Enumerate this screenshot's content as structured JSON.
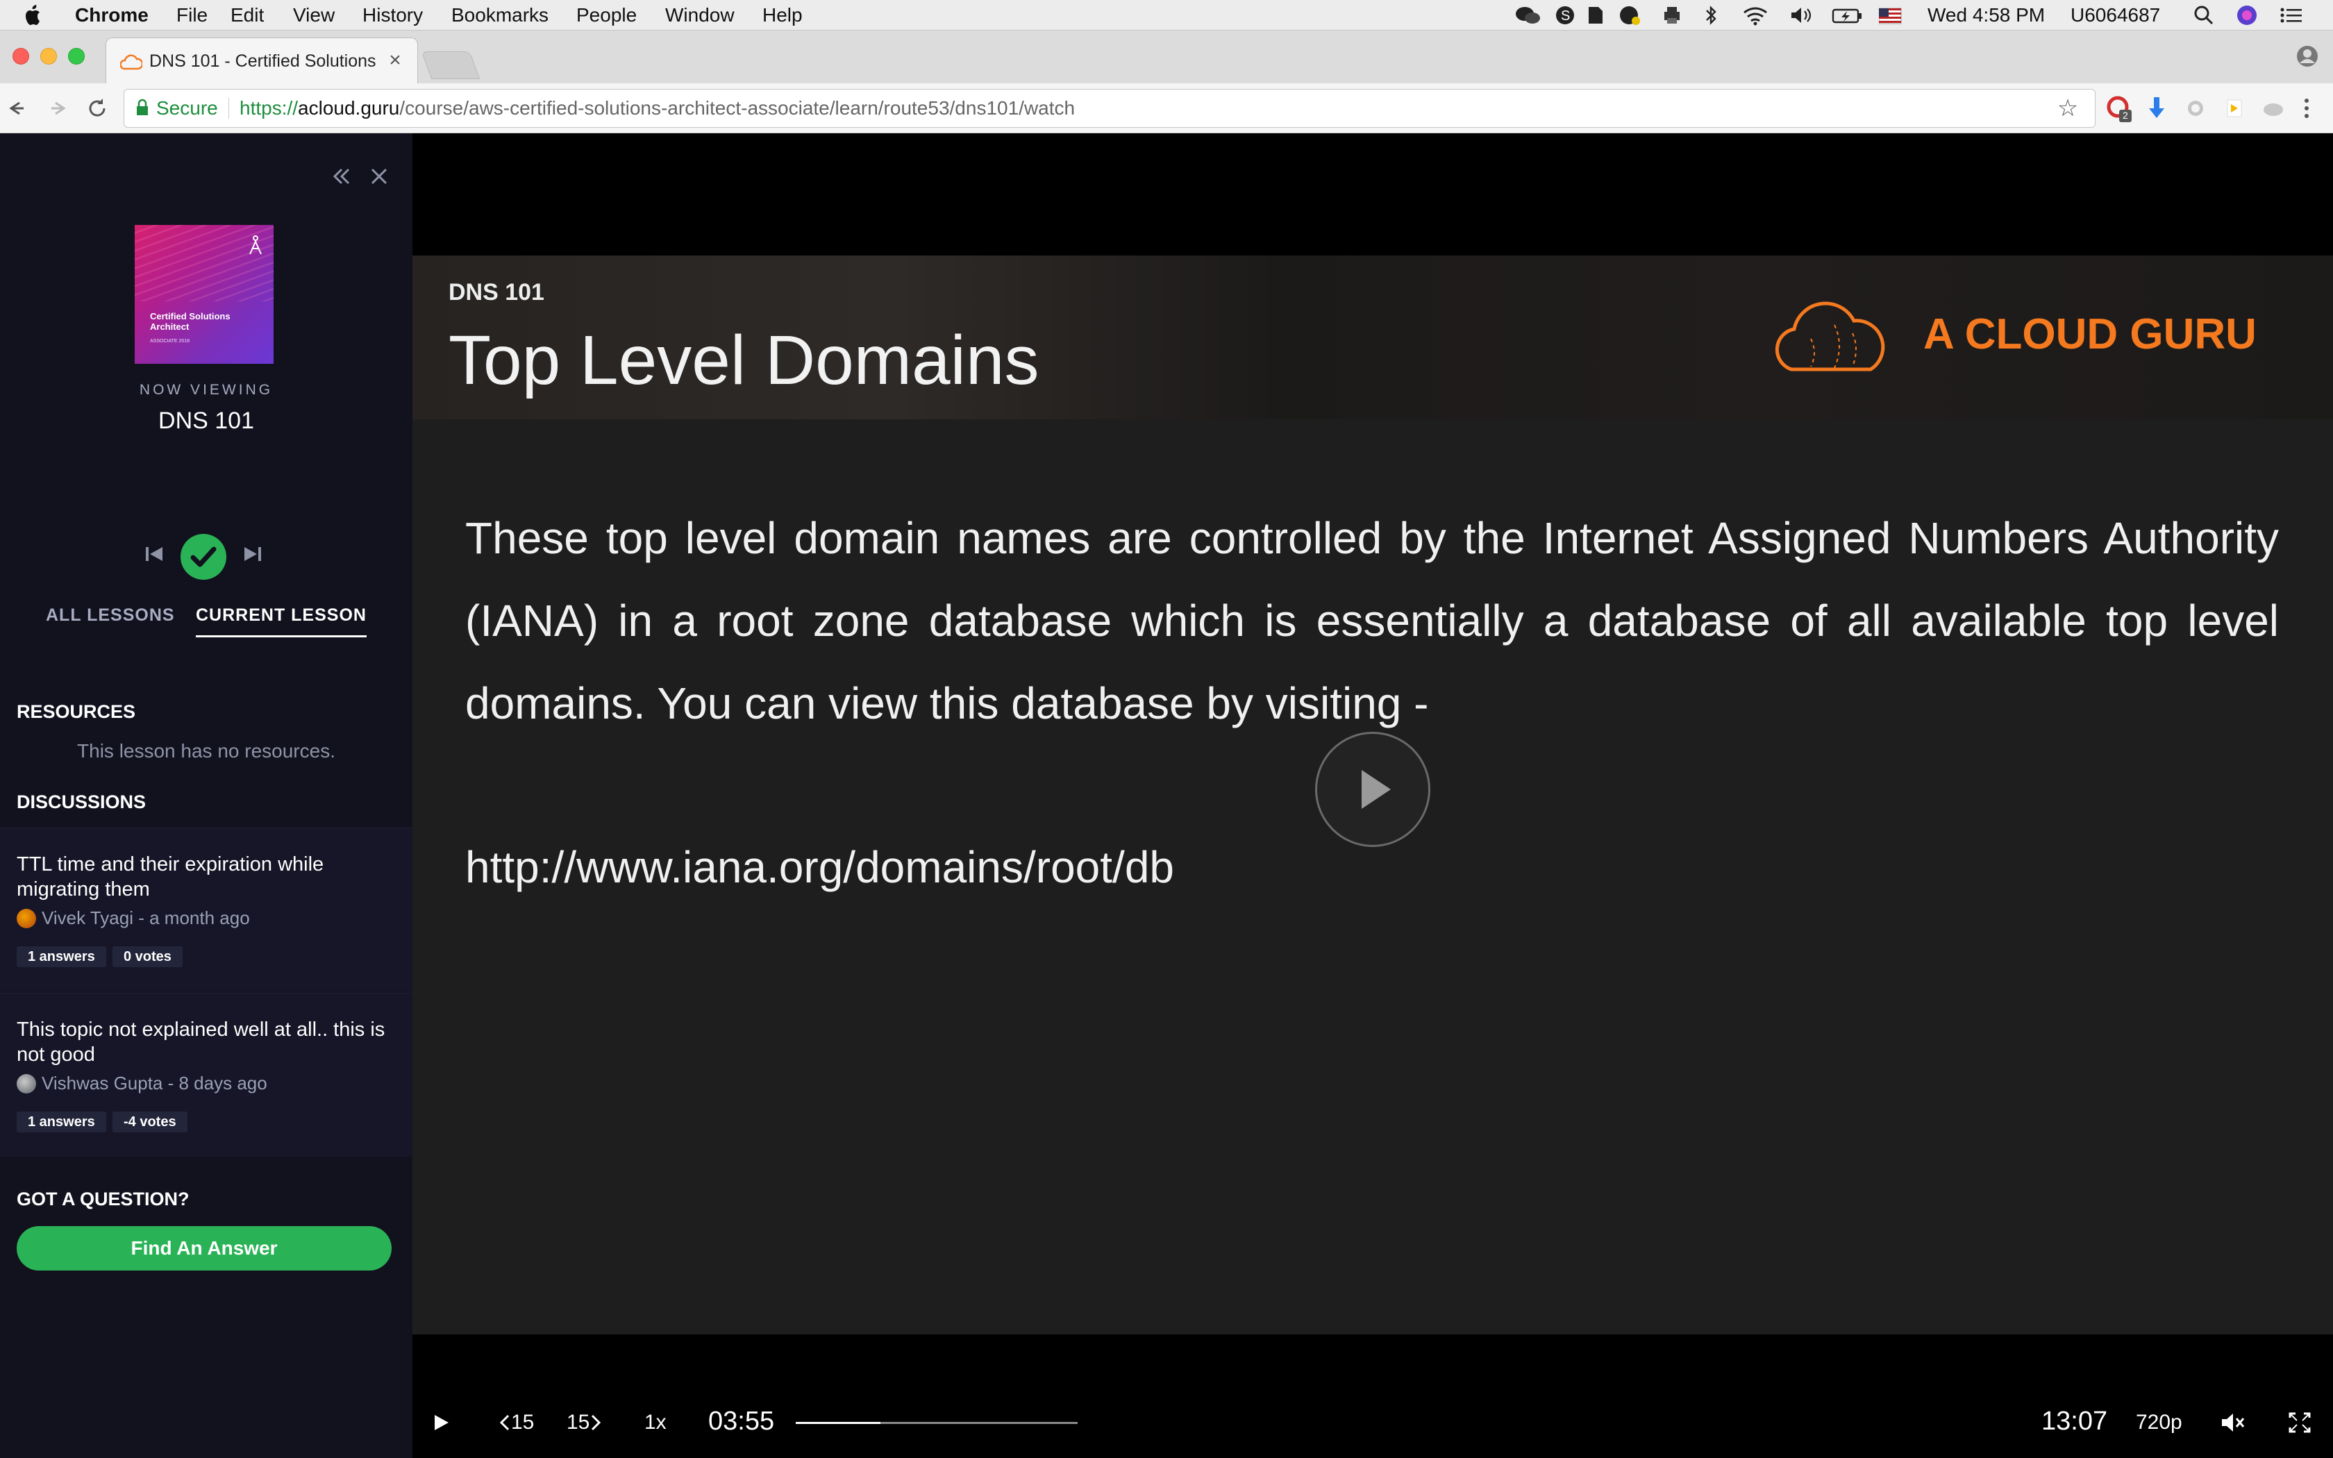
{
  "menubar": {
    "app": "Chrome",
    "items": [
      "File",
      "Edit",
      "View",
      "History",
      "Bookmarks",
      "People",
      "Window",
      "Help"
    ],
    "clock": "Wed 4:58 PM",
    "user": "U6064687"
  },
  "browser": {
    "tab_title": "DNS 101 - Certified Solutions A",
    "tab_close": "×",
    "secure_label": "Secure",
    "url_scheme": "https://",
    "url_host": "acloud.guru",
    "url_path": "/course/aws-certified-solutions-architect-associate/learn/route53/dns101/watch",
    "extension_badge": "2"
  },
  "sidebar": {
    "thumbnail": {
      "title": "Certified Solutions Architect",
      "subtitle": "ASSOCIATE 2018"
    },
    "now_viewing_label": "NOW VIEWING",
    "lesson_name": "DNS 101",
    "tabs": [
      {
        "label": "ALL LESSONS",
        "active": false
      },
      {
        "label": "CURRENT LESSON",
        "active": true
      }
    ],
    "resources_heading": "RESOURCES",
    "resources_empty": "This lesson has no resources.",
    "discussions_heading": "DISCUSSIONS",
    "discussions": [
      {
        "title": "TTL time and their expiration while migrating them",
        "author": "Vivek Tyagi - a month ago",
        "answers": "1 answers",
        "votes": "0 votes"
      },
      {
        "title": "This topic not explained well at all.. this is not good",
        "author": "Vishwas Gupta - 8 days ago",
        "answers": "1 answers",
        "votes": "-4 votes"
      }
    ],
    "question_heading": "GOT A QUESTION?",
    "find_answer_label": "Find An Answer"
  },
  "video": {
    "kicker": "DNS 101",
    "title": "Top Level Domains",
    "brand": "A CLOUD GURU",
    "body": "These top level domain names are controlled by the Internet Assigned Numbers Authority (IANA) in a root zone database which is essentially a database of all available top level domains. You can view this database by visiting -",
    "link": "http://www.iana.org/domains/root/db"
  },
  "controls": {
    "rewind_label": "15",
    "forward_label": "15",
    "speed": "1x",
    "current_time": "03:55",
    "duration": "13:07",
    "quality": "720p",
    "progress_fraction": 0.3
  },
  "colors": {
    "accent_green": "#2ab356",
    "brand_orange": "#f4791f",
    "sidebar_bg": "#12121f"
  }
}
